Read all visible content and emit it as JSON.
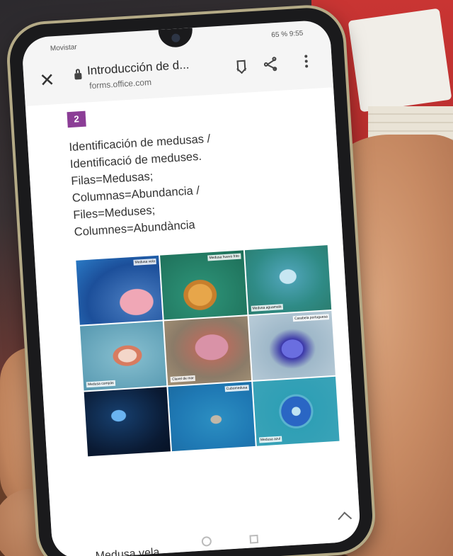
{
  "status_bar": {
    "carrier": "Movistar",
    "right": "65 %  9:55"
  },
  "browser": {
    "title": "Introducción de d...",
    "domain": "forms.office.com",
    "icons": [
      "close-icon",
      "lock-icon",
      "bookmark-icon",
      "share-icon",
      "more-vert-icon"
    ]
  },
  "question": {
    "number": "2",
    "lines": [
      "Identificación de medusas /",
      "Identificació de meduses.",
      "Filas=Medusas;",
      "Columnas=Abundancia /",
      "Files=Meduses;",
      "Columnes=Abundància"
    ]
  },
  "grid": {
    "tile_labels": [
      "Medusa vela",
      "Medusa huevo frito",
      "Medusa aguamala",
      "Medusa compás",
      "Clavel de mar",
      "Carabela portuguesa",
      "",
      "Cubomedusa",
      "Medusa azul"
    ]
  },
  "answer": {
    "first_row": "Medusa vela"
  },
  "colors": {
    "accent": "#8b3d96",
    "phone_frame": "#b4aa86"
  }
}
